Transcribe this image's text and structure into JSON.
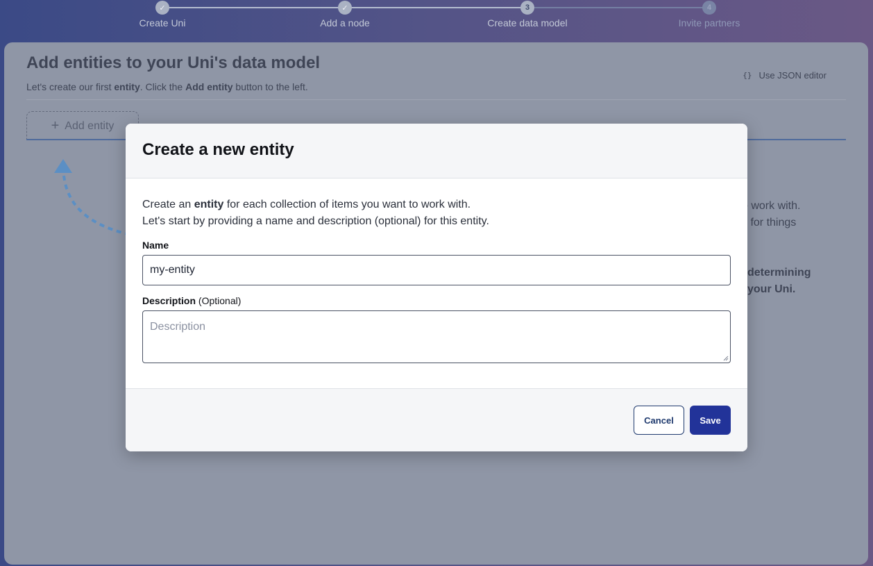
{
  "stepper": {
    "steps": [
      {
        "label": "Create Uni",
        "marker": "✓",
        "state": "done"
      },
      {
        "label": "Add a node",
        "marker": "✓",
        "state": "done"
      },
      {
        "label": "Create data model",
        "marker": "3",
        "state": "current"
      },
      {
        "label": "Invite partners",
        "marker": "4",
        "state": "todo"
      }
    ]
  },
  "page": {
    "title": "Add entities to your Uni's data model",
    "subtitle_pre": "Let's create our first ",
    "subtitle_entity": "entity",
    "subtitle_mid": ". Click the ",
    "subtitle_add": "Add entity",
    "subtitle_post": " button to the left.",
    "json_editor_icon": "{}",
    "json_editor_label": "Use JSON editor",
    "add_entity_icon": "+",
    "add_entity_label": "Add entity",
    "bg_line1": "o work with.",
    "bg_line2": "s for things",
    "bg_line3": "determining",
    "bg_line4": "your Uni."
  },
  "modal": {
    "title": "Create a new entity",
    "intro_pre": "Create an ",
    "intro_bold": "entity",
    "intro_post": " for each collection of items you want to work with.",
    "intro_line2": "Let's start by providing a name and description (optional) for this entity.",
    "name_label": "Name",
    "name_value": "my-entity",
    "description_label": "Description",
    "description_optional": " (Optional)",
    "description_placeholder": "Description",
    "cancel_label": "Cancel",
    "save_label": "Save"
  },
  "colors": {
    "primary": "#223399",
    "backdrop_card": "#8f96a6",
    "arrow": "#5b8fc4"
  }
}
